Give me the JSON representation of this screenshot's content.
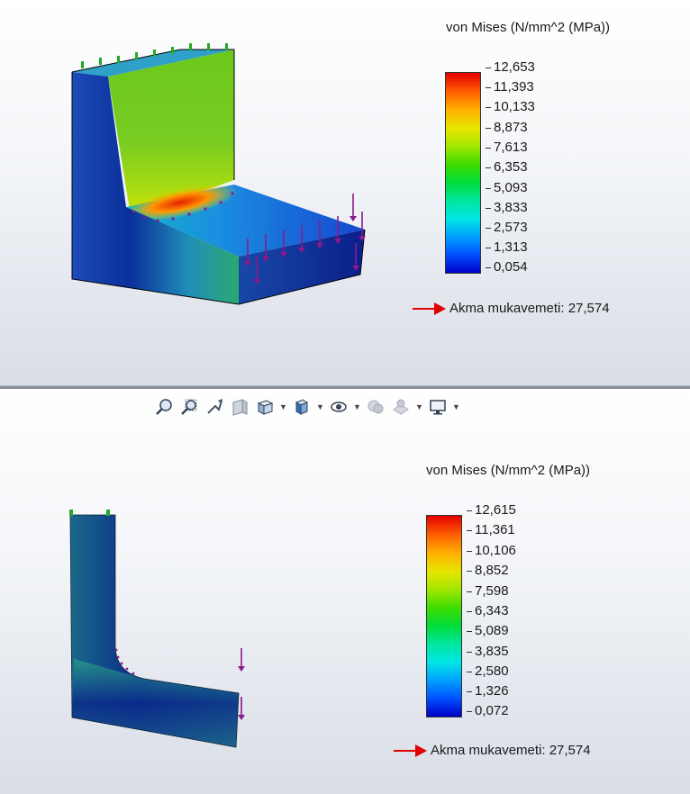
{
  "top_view": {
    "legend_title": "von Mises (N/mm^2 (MPa))",
    "ticks": [
      "12,653",
      "11,393",
      "10,133",
      "8,873",
      "7,613",
      "6,353",
      "5,093",
      "3,833",
      "2,573",
      "1,313",
      "0,054"
    ],
    "yield_label": "Akma mukavemeti: 27,574"
  },
  "bottom_view": {
    "legend_title": "von Mises (N/mm^2 (MPa))",
    "ticks": [
      "12,615",
      "11,361",
      "10,106",
      "8,852",
      "7,598",
      "6,343",
      "5,089",
      "3,835",
      "2,580",
      "1,326",
      "0,072"
    ],
    "yield_label": "Akma mukavemeti: 27,574"
  },
  "toolbar": {
    "icons": [
      "zoom-to-fit-icon",
      "zoom-to-area-icon",
      "previous-view-icon",
      "section-view-icon",
      "view-orientation-icon",
      "display-style-icon",
      "hide-show-items-icon",
      "edit-appearance-icon",
      "apply-scene-icon",
      "view-settings-icon"
    ]
  },
  "colors": {
    "yield_arrow": "#e00000",
    "fixture_marker": "#22aa22",
    "load_marker": "#8b1a8b"
  }
}
